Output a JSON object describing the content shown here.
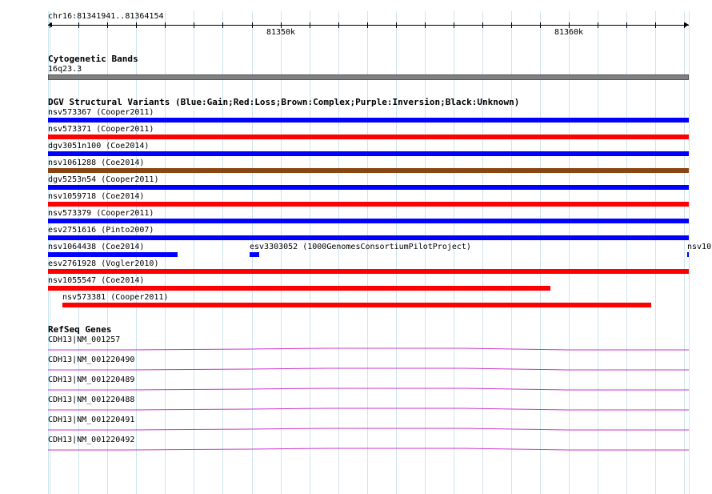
{
  "ruler": {
    "location": "chr16:81341941..81364154",
    "start": 81341941,
    "end": 81364154,
    "major_ticks": [
      {
        "pos": 81350000,
        "label": "81350k"
      },
      {
        "pos": 81360000,
        "label": "81360k"
      }
    ]
  },
  "cytoband": {
    "title": "Cytogenetic Bands",
    "band": "16q23.3",
    "color": "#808080"
  },
  "dgv": {
    "title": "DGV Structural Variants (Blue:Gain;Red:Loss;Brown:Complex;Purple:Inversion;Black:Unknown)",
    "colors": {
      "gain": "#0000ff",
      "loss": "#ff0000",
      "complex": "#8b4513",
      "inversion": "#800080",
      "unknown": "#000000"
    },
    "rows": [
      [
        {
          "label": "nsv573367 (Cooper2011)",
          "type": "gain",
          "start": 81341941,
          "end": 81364154,
          "full": true
        }
      ],
      [
        {
          "label": "nsv573371 (Cooper2011)",
          "type": "loss",
          "start": 81341941,
          "end": 81364154,
          "full": true
        }
      ],
      [
        {
          "label": "dgv3051n100 (Coe2014)",
          "type": "gain",
          "start": 81341941,
          "end": 81364154,
          "full": true
        }
      ],
      [
        {
          "label": "nsv1061288 (Coe2014)",
          "type": "complex",
          "start": 81341941,
          "end": 81364154,
          "full": true
        }
      ],
      [
        {
          "label": "dgv5253n54 (Cooper2011)",
          "type": "gain",
          "start": 81341941,
          "end": 81364154,
          "full": true
        }
      ],
      [
        {
          "label": "nsv1059718 (Coe2014)",
          "type": "loss",
          "start": 81341941,
          "end": 81364154,
          "full": true
        }
      ],
      [
        {
          "label": "nsv573379 (Cooper2011)",
          "type": "gain",
          "start": 81341941,
          "end": 81364154,
          "full": true
        }
      ],
      [
        {
          "label": "esv2751616 (Pinto2007)",
          "type": "gain",
          "start": 81341941,
          "end": 81364154,
          "full": true
        }
      ],
      [
        {
          "label": "nsv1064438 (Coe2014)",
          "type": "gain",
          "start": 81341941,
          "end": 81346420
        },
        {
          "label": "esv3303052 (1000GenomesConsortiumPilotProject)",
          "type": "gain",
          "start": 81348920,
          "end": 81349250
        },
        {
          "label": "nsv10",
          "type": "gain",
          "start": 81364100,
          "end": 81364154
        }
      ],
      [
        {
          "label": "esv2761928 (Vogler2010)",
          "type": "loss",
          "start": 81341941,
          "end": 81364154,
          "full": true
        }
      ],
      [
        {
          "label": "nsv1055547 (Coe2014)",
          "type": "loss",
          "start": 81341941,
          "end": 81359370
        }
      ],
      [
        {
          "label": "nsv573381 (Cooper2011)",
          "type": "loss",
          "start": 81342440,
          "end": 81362850
        }
      ]
    ]
  },
  "refseq": {
    "title": "RefSeq Genes",
    "color": "#cc33cc",
    "genes": [
      "CDH13|NM_001257",
      "CDH13|NM_001220490",
      "CDH13|NM_001220489",
      "CDH13|NM_001220488",
      "CDH13|NM_001220491",
      "CDH13|NM_001220492"
    ]
  }
}
